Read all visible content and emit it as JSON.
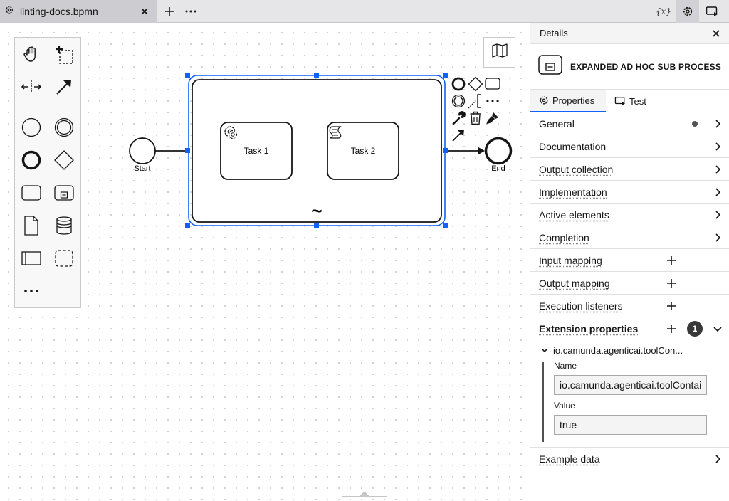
{
  "tabbar": {
    "file_tab_label": "linting-docs.bpmn",
    "variables_label": "{x}"
  },
  "diagram": {
    "start_label": "Start",
    "end_label": "End",
    "task1_label": "Task 1",
    "task2_label": "Task 2",
    "adhoc_marker": "~"
  },
  "panel": {
    "title": "Details",
    "element_type": "EXPANDED AD HOC SUB PROCESS",
    "tabs": [
      {
        "label": "Properties",
        "active": true
      },
      {
        "label": "Test",
        "active": false
      }
    ],
    "groups": {
      "general": "General",
      "documentation": "Documentation",
      "output_collection": "Output collection",
      "implementation": "Implementation",
      "active_elements": "Active elements",
      "completion": "Completion",
      "input_mapping": "Input mapping",
      "output_mapping": "Output mapping",
      "execution_listeners": "Execution listeners",
      "extension_properties": "Extension properties",
      "example_data": "Example data"
    },
    "extension": {
      "badge_count": "1",
      "item_title": "io.camunda.agenticai.toolCon...",
      "name_label": "Name",
      "name_value": "io.camunda.agenticai.toolContainer",
      "value_label": "Value",
      "value_value": "true"
    }
  },
  "colors": {
    "selection": "#0f62fe",
    "accent_tab": "#0f62fe"
  }
}
